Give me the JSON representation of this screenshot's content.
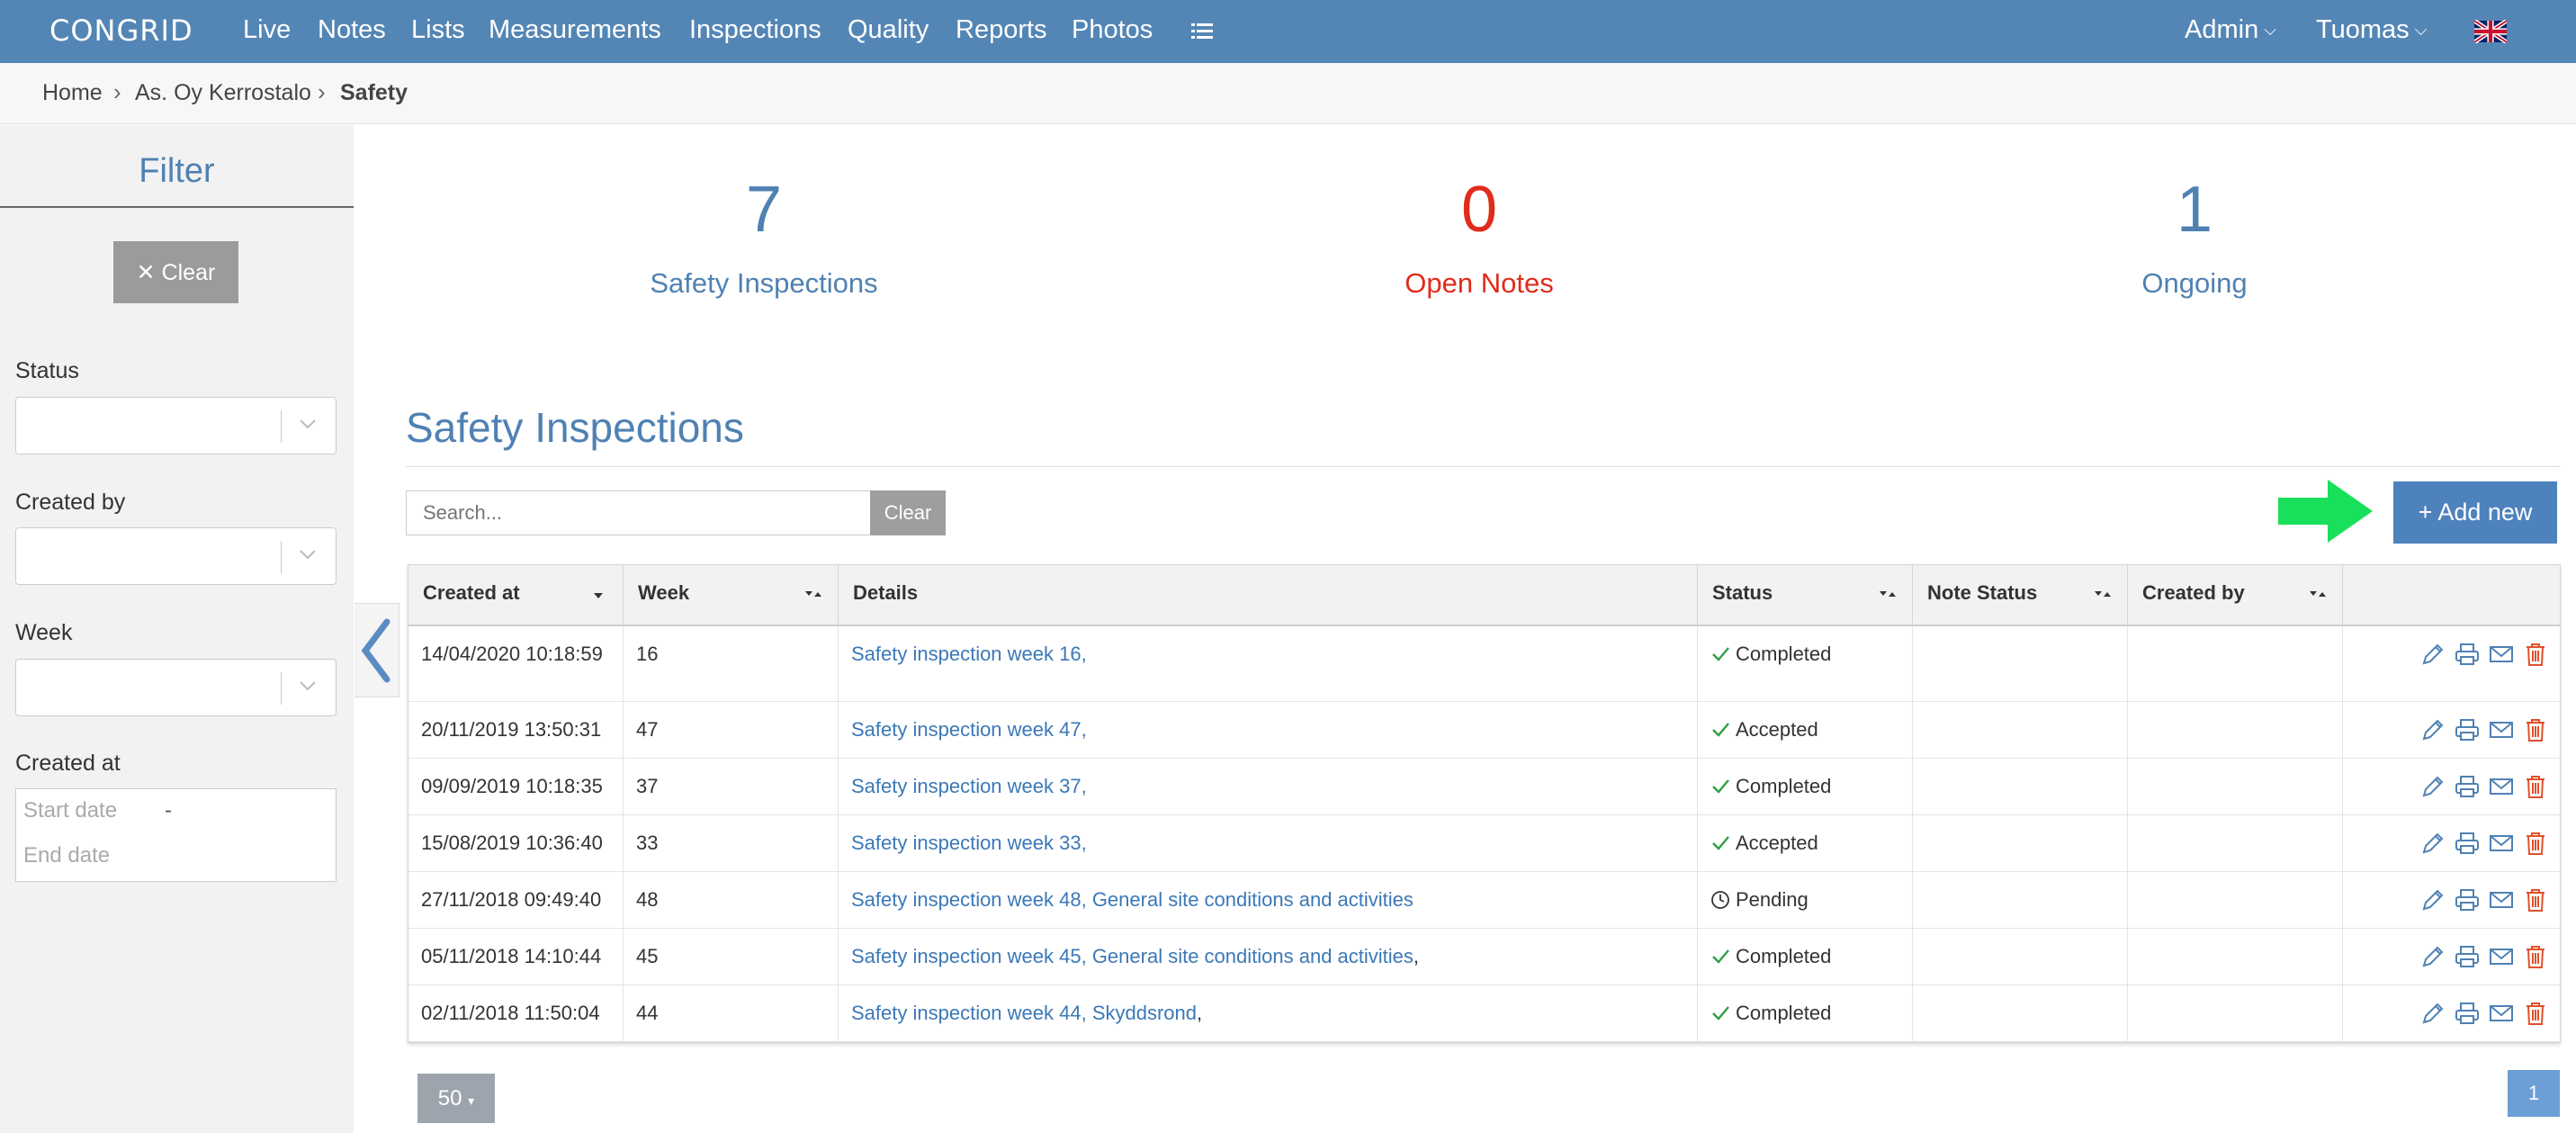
{
  "nav": {
    "logo": "CONGRID",
    "items": [
      "Live",
      "Notes",
      "Lists",
      "Measurements",
      "Inspections",
      "Quality",
      "Reports",
      "Photos"
    ],
    "admin": "Admin",
    "user": "Tuomas",
    "bar_color": "#5486b5"
  },
  "breadcrumb": {
    "home": "Home",
    "project": "As. Oy Kerrostalo",
    "current": "Safety"
  },
  "filter": {
    "title": "Filter",
    "clear_label": "✕ Clear",
    "status_label": "Status",
    "created_by_label": "Created by",
    "week_label": "Week",
    "created_at_label": "Created at",
    "start_date_placeholder": "Start date",
    "end_date_placeholder": "End date",
    "date_separator": "-"
  },
  "stats": [
    {
      "value": "7",
      "label": "Safety Inspections",
      "color": "#4f81b3"
    },
    {
      "value": "0",
      "label": "Open Notes",
      "color": "#e02c1b"
    },
    {
      "value": "1",
      "label": "Ongoing",
      "color": "#4f81b3"
    }
  ],
  "main": {
    "title": "Safety Inspections",
    "search_placeholder": "Search...",
    "search_clear": "Clear",
    "add_new": "+ Add new",
    "arrow_color": "#19e05a"
  },
  "table": {
    "headers": [
      "Created at",
      "Week",
      "Details",
      "Status",
      "Note Status",
      "Created by"
    ],
    "rows": [
      {
        "created_at": "14/04/2020 10:18:59",
        "week": "16",
        "details": "Safety inspection week 16,",
        "details_suffix": "",
        "status": "Completed",
        "status_icon": "check-icon"
      },
      {
        "created_at": "20/11/2019 13:50:31",
        "week": "47",
        "details": "Safety inspection week 47,",
        "details_suffix": "",
        "status": "Accepted",
        "status_icon": "check-icon"
      },
      {
        "created_at": "09/09/2019 10:18:35",
        "week": "37",
        "details": "Safety inspection week 37,",
        "details_suffix": "",
        "status": "Completed",
        "status_icon": "check-icon"
      },
      {
        "created_at": "15/08/2019 10:36:40",
        "week": "33",
        "details": "Safety inspection week 33,",
        "details_suffix": "",
        "status": "Accepted",
        "status_icon": "check-icon"
      },
      {
        "created_at": "27/11/2018 09:49:40",
        "week": "48",
        "details": "Safety inspection week 48, General site conditions and activities",
        "details_suffix": "",
        "status": "Pending",
        "status_icon": "clock-icon"
      },
      {
        "created_at": "05/11/2018 14:10:44",
        "week": "45",
        "details": "Safety inspection week 45, General site conditions and activities",
        "details_suffix": ",",
        "status": "Completed",
        "status_icon": "check-icon"
      },
      {
        "created_at": "02/11/2018 11:50:04",
        "week": "44",
        "details": "Safety inspection week 44, Skyddsrond",
        "details_suffix": ",",
        "status": "Completed",
        "status_icon": "check-icon"
      }
    ]
  },
  "footer": {
    "page_size": "50",
    "current_page": "1"
  }
}
